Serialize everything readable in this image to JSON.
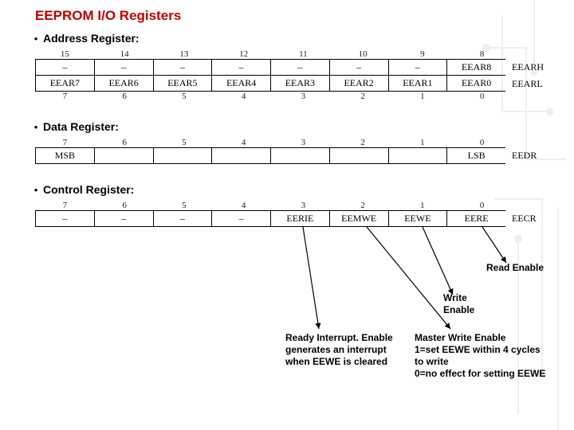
{
  "title": "EEPROM I/O Registers",
  "sections": {
    "address": {
      "label": "Address Register:",
      "bits_hi": [
        "15",
        "14",
        "13",
        "12",
        "11",
        "10",
        "9",
        "8"
      ],
      "bits_lo": [
        "7",
        "6",
        "5",
        "4",
        "3",
        "2",
        "1",
        "0"
      ],
      "row_hi": [
        "–",
        "–",
        "–",
        "–",
        "–",
        "–",
        "–",
        "EEAR8"
      ],
      "row_lo": [
        "EEAR7",
        "EEAR6",
        "EEAR5",
        "EEAR4",
        "EEAR3",
        "EEAR2",
        "EEAR1",
        "EEAR0"
      ],
      "name_hi": "EEARH",
      "name_lo": "EEARL"
    },
    "data": {
      "label": "Data Register:",
      "bits": [
        "7",
        "6",
        "5",
        "4",
        "3",
        "2",
        "1",
        "0"
      ],
      "cells": [
        "MSB",
        "",
        "",
        "",
        "",
        "",
        "",
        "LSB"
      ],
      "name": "EEDR"
    },
    "control": {
      "label": "Control Register:",
      "bits": [
        "7",
        "6",
        "5",
        "4",
        "3",
        "2",
        "1",
        "0"
      ],
      "cells": [
        "–",
        "–",
        "–",
        "–",
        "EERIE",
        "EEMWE",
        "EEWE",
        "EERE"
      ],
      "name": "EECR"
    }
  },
  "annotations": {
    "read_enable": "Read Enable",
    "write_enable": "Write\nEnable",
    "ready_int": "Ready Interrupt. Enable\ngenerates an interrupt when EEWE is cleared",
    "master_we": "Master Write Enable\n1=set EEWE within 4 cycles to write\n0=no effect for setting EEWE"
  }
}
